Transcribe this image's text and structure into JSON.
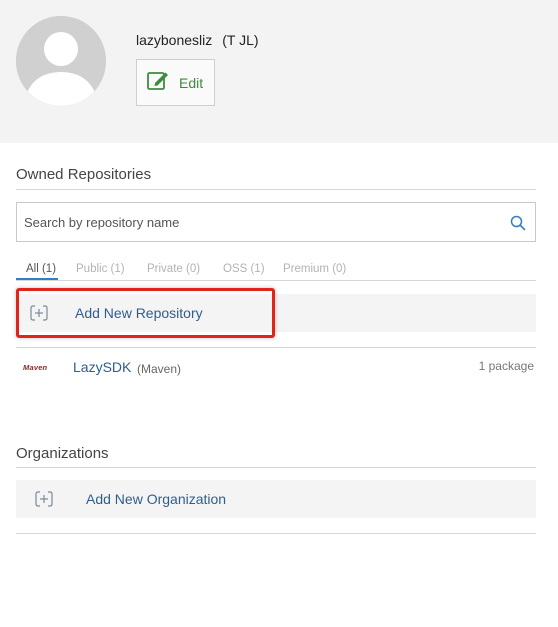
{
  "profile": {
    "username": "lazybonesliz",
    "fullname": "(T JL)",
    "edit_label": "Edit"
  },
  "repositories": {
    "title": "Owned Repositories",
    "search_placeholder": "Search by repository name",
    "tabs": [
      {
        "label": "All (1)",
        "active": true
      },
      {
        "label": "Public (1)",
        "active": false
      },
      {
        "label": "Private (0)",
        "active": false
      },
      {
        "label": "OSS (1)",
        "active": false
      },
      {
        "label": "Premium (0)",
        "active": false
      }
    ],
    "add_label": "Add New Repository",
    "items": [
      {
        "logo_text": "Maven",
        "name": "LazySDK",
        "type": "(Maven)",
        "count": "1 package"
      }
    ]
  },
  "organizations": {
    "title": "Organizations",
    "add_label": "Add New Organization"
  },
  "colors": {
    "link": "#2f5e8c",
    "edit": "#3d8b3d",
    "highlight": "#e0231b",
    "tab_active_underline": "#2f7ec7"
  }
}
